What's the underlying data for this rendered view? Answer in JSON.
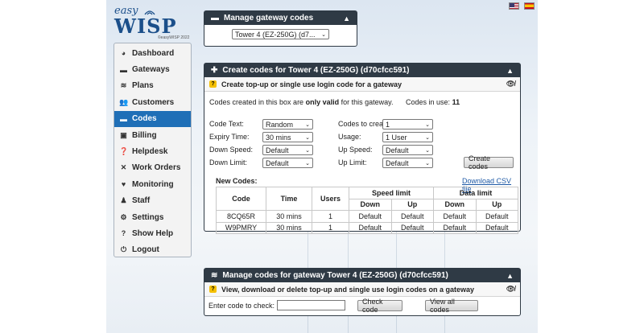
{
  "logo": {
    "top": "easy",
    "main": "WISP",
    "copyright": "©easyWISP 2022"
  },
  "sidebar": {
    "items": [
      {
        "label": "Dashboard",
        "icon": "dashboard-icon"
      },
      {
        "label": "Gateways",
        "icon": "gateway-icon"
      },
      {
        "label": "Plans",
        "icon": "plans-icon"
      },
      {
        "label": "Customers",
        "icon": "customers-icon"
      },
      {
        "label": "Codes",
        "icon": "codes-icon",
        "active": true
      },
      {
        "label": "Billing",
        "icon": "billing-icon"
      },
      {
        "label": "Helpdesk",
        "icon": "helpdesk-icon"
      },
      {
        "label": "Work Orders",
        "icon": "wrench-icon"
      },
      {
        "label": "Monitoring",
        "icon": "heart-icon"
      },
      {
        "label": "Staff",
        "icon": "staff-icon"
      },
      {
        "label": "Settings",
        "icon": "gear-icon"
      },
      {
        "label": "Show Help",
        "icon": "question-icon"
      },
      {
        "label": "Logout",
        "icon": "power-icon"
      }
    ]
  },
  "gateway_panel": {
    "title": "Manage gateway codes",
    "selected": "Tower 4 (EZ-250G) (d7..."
  },
  "create_panel": {
    "title": "Create codes for Tower 4 (EZ-250G) (d70cfcc591)",
    "subtitle": "Create top-up or single use login code for a gateway",
    "notice_pre": "Codes created in this box are ",
    "notice_bold": "only valid",
    "notice_post": " for this gateway.",
    "codes_in_use_label": "Codes in use:",
    "codes_in_use": "11",
    "fields": {
      "code_text_label": "Code Text:",
      "code_text": "Random",
      "expiry_label": "Expiry Time:",
      "expiry": "30 mins",
      "down_speed_label": "Down Speed:",
      "down_speed": "Default",
      "down_limit_label": "Down Limit:",
      "down_limit": "Default",
      "codes_to_create_label": "Codes to create:",
      "codes_to_create": "1",
      "usage_label": "Usage:",
      "usage": "1 User",
      "up_speed_label": "Up Speed:",
      "up_speed": "Default",
      "up_limit_label": "Up Limit:",
      "up_limit": "Default"
    },
    "create_button": "Create codes",
    "new_codes_label": "New Codes:",
    "download_link": "Download CSV file",
    "table": {
      "headers": {
        "code": "Code",
        "time": "Time",
        "users": "Users",
        "speed": "Speed limit",
        "data": "Data limit",
        "down": "Down",
        "up": "Up"
      },
      "rows": [
        {
          "code": "8CQ65R",
          "time": "30 mins",
          "users": "1",
          "sd": "Default",
          "su": "Default",
          "dd": "Default",
          "du": "Default"
        },
        {
          "code": "W9PMRY",
          "time": "30 mins",
          "users": "1",
          "sd": "Default",
          "su": "Default",
          "dd": "Default",
          "du": "Default"
        }
      ]
    }
  },
  "manage_panel": {
    "title": "Manage codes for gateway Tower 4 (EZ-250G) (d70cfcc591)",
    "subtitle": "View, download or delete top-up and single use login codes on a gateway",
    "check_label": "Enter code to check:",
    "check_value": "",
    "check_button": "Check code",
    "view_all_button": "View all codes"
  }
}
